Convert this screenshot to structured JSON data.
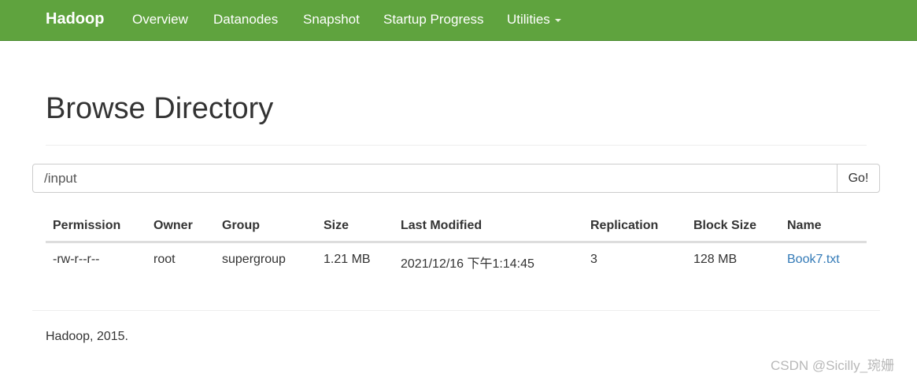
{
  "navbar": {
    "brand": "Hadoop",
    "items": [
      {
        "label": "Overview"
      },
      {
        "label": "Datanodes"
      },
      {
        "label": "Snapshot"
      },
      {
        "label": "Startup Progress"
      },
      {
        "label": "Utilities"
      }
    ],
    "background_color": "#5fa33e"
  },
  "page_title": "Browse Directory",
  "path_bar": {
    "value": "/input",
    "go_label": "Go!"
  },
  "table": {
    "headers": [
      "Permission",
      "Owner",
      "Group",
      "Size",
      "Last Modified",
      "Replication",
      "Block Size",
      "Name"
    ],
    "rows": [
      {
        "permission": "-rw-r--r--",
        "owner": "root",
        "group": "supergroup",
        "size": "1.21 MB",
        "last_modified": "2021/12/16 下午1:14:45",
        "replication": "3",
        "block_size": "128 MB",
        "name": "Book7.txt"
      }
    ]
  },
  "footer": {
    "text": "Hadoop, 2015."
  },
  "watermark": "CSDN @Sicilly_琬姗",
  "colors": {
    "link": "#337ab7"
  }
}
